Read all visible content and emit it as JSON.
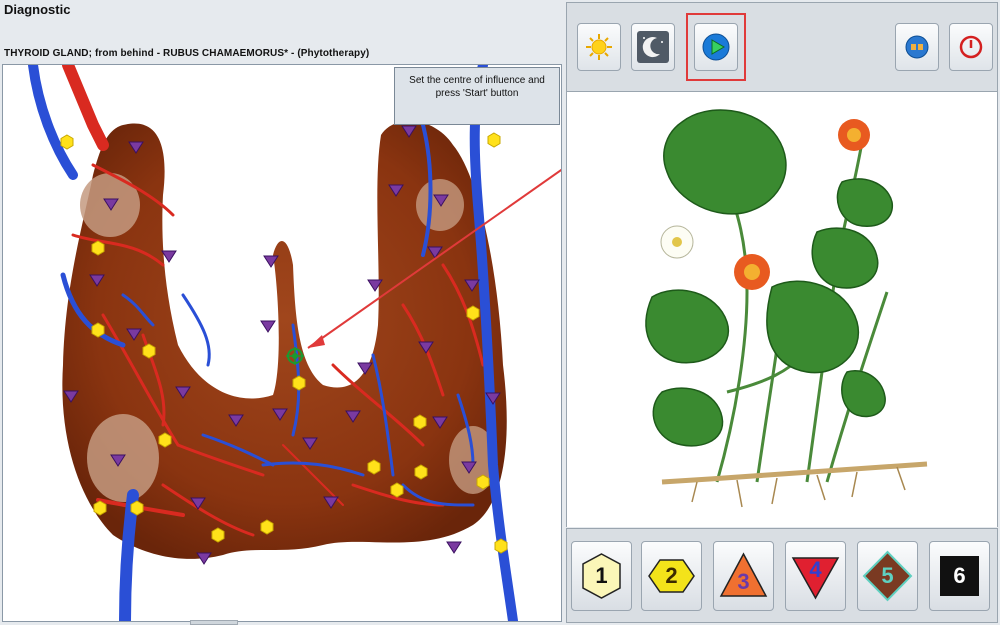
{
  "window": {
    "title": "Diagnostic",
    "subtitle": "THYROID GLAND; from behind - RUBUS  CHAMAEMORUS* - (Phytotherapy)"
  },
  "hint": {
    "text": "Set the centre of influence and press 'Start' button"
  },
  "toolbar": {
    "buttons": [
      {
        "name": "sun-button",
        "icon": "sun-icon"
      },
      {
        "name": "moon-button",
        "icon": "moon-icon"
      },
      {
        "name": "start-button",
        "icon": "play-icon"
      },
      {
        "name": "sound-button",
        "icon": "speaker-icon"
      },
      {
        "name": "power-button",
        "icon": "power-icon"
      }
    ]
  },
  "levels": [
    {
      "label": "1",
      "shape": "hexagon-outline",
      "color": "#fbf6b8"
    },
    {
      "label": "2",
      "shape": "hexagon",
      "color": "#f3e31a"
    },
    {
      "label": "3",
      "shape": "triangle",
      "color": "#f07030",
      "text_color": "#6a3aa8"
    },
    {
      "label": "4",
      "shape": "triangle-down",
      "color": "#e02030",
      "text_color": "#3040d0"
    },
    {
      "label": "5",
      "shape": "diamond",
      "color": "#7a3a22",
      "text_color": "#5fd0c0"
    },
    {
      "label": "6",
      "shape": "square",
      "color": "#111111",
      "text_color": "#ffffff"
    }
  ],
  "colors": {
    "gland": "#8a3410",
    "vein": "#2a4fd6",
    "artery": "#d92a20",
    "marker_hex": "#ffe11a",
    "marker_tri": "#7a3aa0",
    "accent_red": "#e03a3a"
  }
}
